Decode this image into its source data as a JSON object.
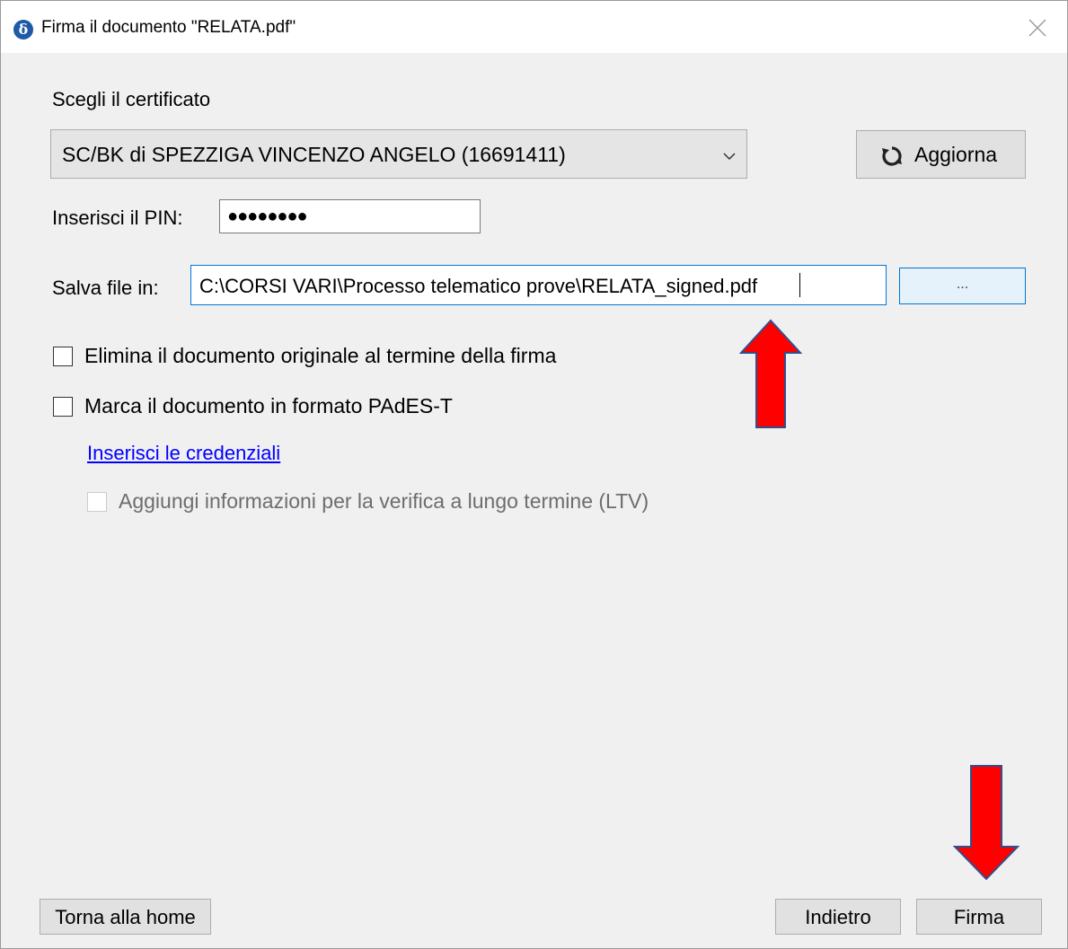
{
  "window": {
    "title": "Firma il documento \"RELATA.pdf\"",
    "app_icon_glyph": "δ"
  },
  "certificate": {
    "label": "Scegli il certificato",
    "selected": "SC/BK di SPEZZIGA VINCENZO ANGELO (16691411)",
    "refresh_label": "Aggiorna"
  },
  "pin": {
    "label": "Inserisci il PIN:",
    "masked_value": "●●●●●●●●"
  },
  "save": {
    "label": "Salva file in:",
    "path": "C:\\CORSI VARI\\Processo telematico prove\\RELATA_signed.pdf",
    "browse_label": "..."
  },
  "options": {
    "delete_original": {
      "label": "Elimina il documento originale al termine della firma",
      "checked": false
    },
    "pades_t": {
      "label": "Marca il documento in formato PAdES-T",
      "checked": false
    },
    "credentials_link": "Inserisci le credenziali",
    "ltv": {
      "label": "Aggiungi informazioni per la verifica a lungo termine (LTV)",
      "checked": false,
      "enabled": false
    }
  },
  "footer": {
    "home_label": "Torna alla home",
    "back_label": "Indietro",
    "sign_label": "Firma"
  },
  "colors": {
    "annotation_arrow": "#ff0000",
    "link": "#0000ff",
    "focus_border": "#0078d7"
  }
}
